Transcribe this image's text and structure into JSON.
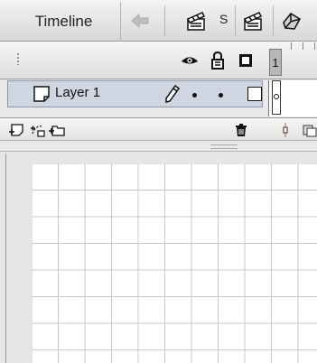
{
  "timeline": {
    "title": "Timeline",
    "scene_label": "S",
    "frame_number": "1"
  },
  "toolbar_icons": [
    "back-arrow-icon",
    "edit-scene-icon",
    "edit-symbol-icon",
    "snap-icon"
  ],
  "layer_header_icons": [
    "eye-icon",
    "lock-icon",
    "outline-icon"
  ],
  "layers": [
    {
      "name": "Layer 1",
      "icon": "layer-page-icon",
      "editing": "pencil-icon"
    }
  ],
  "layer_tools": [
    "insert-layer-icon",
    "add-motion-guide-icon",
    "insert-layer-folder-icon",
    "trash-icon"
  ],
  "colors": {
    "layer_selected": "#cfd6e2",
    "grid_line": "#c8c8c8",
    "stage_bg": "#e6e6e6"
  }
}
